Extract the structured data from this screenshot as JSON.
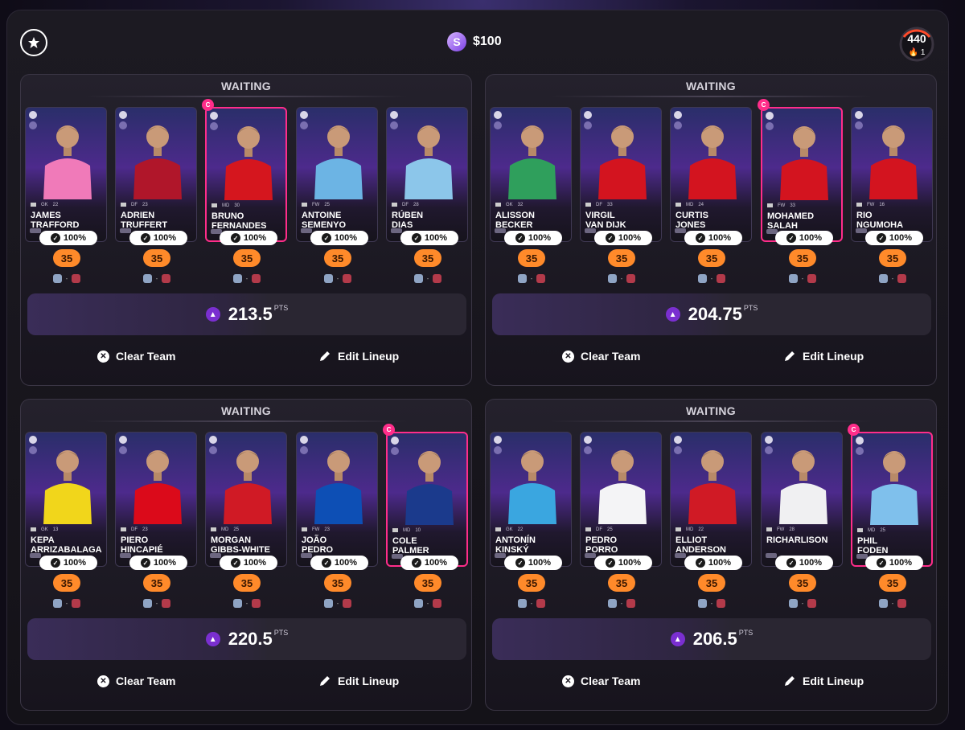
{
  "header": {
    "coins": "$100",
    "coin_symbol": "S",
    "level": "440",
    "streak": "1",
    "streak_icon": "🔥"
  },
  "labels": {
    "clear_team": "Clear Team",
    "edit_lineup": "Edit Lineup",
    "pts_unit": "PTS",
    "captain": "C",
    "check": "✓"
  },
  "teams": [
    {
      "status": "WAITING",
      "points": "213.5",
      "players": [
        {
          "name1": "JAMES",
          "name2": "TRAFFORD",
          "pos": "GK",
          "num": "22",
          "pct": "100%",
          "salary": "35",
          "captain": false,
          "shirt": "#f07ab9"
        },
        {
          "name1": "ADRIEN",
          "name2": "TRUFFERT",
          "pos": "DF",
          "num": "23",
          "pct": "100%",
          "salary": "35",
          "captain": false,
          "shirt": "#b0162a"
        },
        {
          "name1": "BRUNO",
          "name2": "FERNANDES",
          "pos": "MD",
          "num": "30",
          "pct": "100%",
          "salary": "35",
          "captain": true,
          "shirt": "#d5161e"
        },
        {
          "name1": "ANTOINE",
          "name2": "SEMENYO",
          "pos": "FW",
          "num": "25",
          "pct": "100%",
          "salary": "35",
          "captain": false,
          "shirt": "#6cb4e4"
        },
        {
          "name1": "RÚBEN",
          "name2": "DIAS",
          "pos": "DF",
          "num": "28",
          "pct": "100%",
          "salary": "35",
          "captain": false,
          "shirt": "#8cc6ea"
        }
      ]
    },
    {
      "status": "WAITING",
      "points": "204.75",
      "players": [
        {
          "name1": "ALISSON",
          "name2": "BECKER",
          "pos": "GK",
          "num": "32",
          "pct": "100%",
          "salary": "35",
          "captain": false,
          "shirt": "#2f9f5c"
        },
        {
          "name1": "VIRGIL",
          "name2": "VAN DIJK",
          "pos": "DF",
          "num": "33",
          "pct": "100%",
          "salary": "35",
          "captain": false,
          "shirt": "#d3141f"
        },
        {
          "name1": "CURTIS",
          "name2": "JONES",
          "pos": "MD",
          "num": "24",
          "pct": "100%",
          "salary": "35",
          "captain": false,
          "shirt": "#d3141f"
        },
        {
          "name1": "MOHAMED",
          "name2": "SALAH",
          "pos": "FW",
          "num": "33",
          "pct": "100%",
          "salary": "35",
          "captain": true,
          "shirt": "#d3141f"
        },
        {
          "name1": "RIO",
          "name2": "NGUMOHA",
          "pos": "FW",
          "num": "16",
          "pct": "100%",
          "salary": "35",
          "captain": false,
          "shirt": "#d3141f"
        }
      ]
    },
    {
      "status": "WAITING",
      "points": "220.5",
      "players": [
        {
          "name1": "KEPA",
          "name2": "ARRIZABALAGA",
          "pos": "GK",
          "num": "13",
          "pct": "100%",
          "salary": "35",
          "captain": false,
          "shirt": "#f1d61b"
        },
        {
          "name1": "PIERO",
          "name2": "HINCAPIÉ",
          "pos": "DF",
          "num": "23",
          "pct": "100%",
          "salary": "35",
          "captain": false,
          "shirt": "#db0a1a"
        },
        {
          "name1": "MORGAN",
          "name2": "GIBBS-WHITE",
          "pos": "MD",
          "num": "25",
          "pct": "100%",
          "salary": "35",
          "captain": false,
          "shirt": "#d01a25"
        },
        {
          "name1": "JOÃO",
          "name2": "PEDRO",
          "pos": "FW",
          "num": "23",
          "pct": "100%",
          "salary": "35",
          "captain": false,
          "shirt": "#0d4fb5"
        },
        {
          "name1": "COLE",
          "name2": "PALMER",
          "pos": "MD",
          "num": "10",
          "pct": "100%",
          "salary": "35",
          "captain": true,
          "shirt": "#1b3a8c"
        }
      ]
    },
    {
      "status": "WAITING",
      "points": "206.5",
      "players": [
        {
          "name1": "ANTONÍN",
          "name2": "KINSKÝ",
          "pos": "GK",
          "num": "22",
          "pct": "100%",
          "salary": "35",
          "captain": false,
          "shirt": "#3aa6e0"
        },
        {
          "name1": "PEDRO",
          "name2": "PORRO",
          "pos": "DF",
          "num": "25",
          "pct": "100%",
          "salary": "35",
          "captain": false,
          "shirt": "#f4f4f6"
        },
        {
          "name1": "ELLIOT",
          "name2": "ANDERSON",
          "pos": "MD",
          "num": "22",
          "pct": "100%",
          "salary": "35",
          "captain": false,
          "shirt": "#d01a25"
        },
        {
          "name1": "RICHARLISON",
          "name2": "",
          "pos": "FW",
          "num": "28",
          "pct": "100%",
          "salary": "35",
          "captain": false,
          "shirt": "#f0f0f2"
        },
        {
          "name1": "PHIL",
          "name2": "FODEN",
          "pos": "MD",
          "num": "25",
          "pct": "100%",
          "salary": "35",
          "captain": true,
          "shirt": "#7fc0ec"
        }
      ]
    }
  ]
}
